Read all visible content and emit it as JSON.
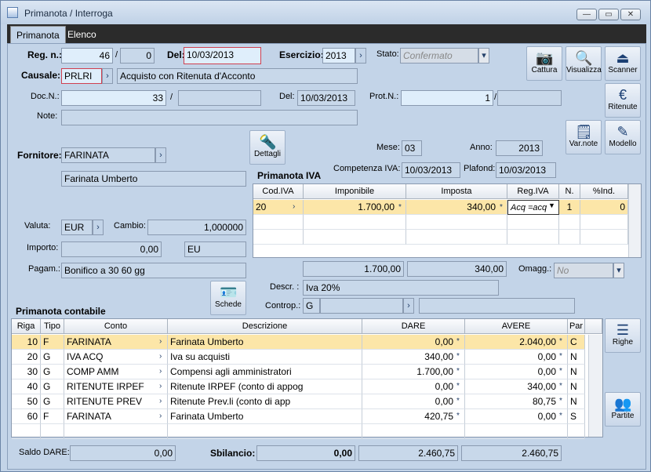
{
  "window": {
    "title": "Primanota / Interroga"
  },
  "tabs": [
    "Primanota",
    "Elenco"
  ],
  "header": {
    "reg_label": "Reg. n.:",
    "reg_num": "46",
    "reg_sep": "/",
    "reg_suffix": "0",
    "del_label": "Del:",
    "del_value": "10/03/2013",
    "esercizio_label": "Esercizio:",
    "esercizio_value": "2013",
    "stato_label": "Stato:",
    "stato_value": "Confermato",
    "causale_label": "Causale:",
    "causale_code": "PRLRI",
    "causale_desc": "Acquisto con Ritenuta d'Acconto",
    "docn_label": "Doc.N.:",
    "docn_value": "33",
    "docn_sep": "/",
    "docn_suffix": "",
    "docdel_label": "Del:",
    "docdel_value": "10/03/2013",
    "prot_label": "Prot.N.:",
    "prot_value": "1",
    "prot_sep": "/",
    "prot_suffix": "",
    "note_label": "Note:",
    "note_value": ""
  },
  "buttons": {
    "cattura": "Cattura",
    "visualizza": "Visualizza",
    "scanner": "Scanner",
    "ritenute": "Ritenute",
    "varnote": "Var.note",
    "modello": "Modello",
    "dettagli": "Dettagli",
    "schede": "Schede",
    "righe": "Righe",
    "partite": "Partite"
  },
  "fornitore": {
    "label": "Fornitore:",
    "code": "FARINATA",
    "name": "Farinata Umberto",
    "valuta_label": "Valuta:",
    "valuta": "EUR",
    "cambio_label": "Cambio:",
    "cambio": "1,000000",
    "importo_label": "Importo:",
    "importo": "0,00",
    "importo_cur": "EU",
    "pagam_label": "Pagam.:",
    "pagam": "Bonifico a 30 60 gg"
  },
  "iva": {
    "mese_label": "Mese:",
    "mese": "03",
    "anno_label": "Anno:",
    "anno": "2013",
    "comp_label": "Competenza IVA:",
    "comp": "10/03/2013",
    "plafond_label": "Plafond:",
    "plafond": "10/03/2013",
    "title": "Primanota IVA",
    "columns": [
      "Cod.IVA",
      "Imponibile",
      "Imposta",
      "Reg.IVA",
      "N.",
      "%Ind."
    ],
    "row": {
      "cod": "20",
      "imponibile": "1.700,00",
      "imposta": "340,00",
      "reg": "Acq =acq",
      "n": "1",
      "ind": "0"
    },
    "tot_imponibile": "1.700,00",
    "tot_imposta": "340,00",
    "omagg_label": "Omagg.:",
    "omagg": "No",
    "descr_label": "Descr. :",
    "descr": "Iva 20%",
    "controp_label": "Controp.:",
    "controp": "G"
  },
  "contabile": {
    "title": "Primanota contabile",
    "columns": [
      "Riga",
      "Tipo",
      "Conto",
      "Descrizione",
      "DARE",
      "AVERE",
      "Par"
    ],
    "rows": [
      {
        "riga": "10",
        "tipo": "F",
        "conto": "FARINATA",
        "desc": "Farinata Umberto",
        "dare": "0,00",
        "avere": "2.040,00",
        "par": "C"
      },
      {
        "riga": "20",
        "tipo": "G",
        "conto": "IVA ACQ",
        "desc": "Iva su acquisti",
        "dare": "340,00",
        "avere": "0,00",
        "par": "N"
      },
      {
        "riga": "30",
        "tipo": "G",
        "conto": "COMP AMM",
        "desc": "Compensi agli amministratori",
        "dare": "1.700,00",
        "avere": "0,00",
        "par": "N"
      },
      {
        "riga": "40",
        "tipo": "G",
        "conto": "RITENUTE IRPEF",
        "desc": "Ritenute IRPEF (conto di appog",
        "dare": "0,00",
        "avere": "340,00",
        "par": "N"
      },
      {
        "riga": "50",
        "tipo": "G",
        "conto": "RITENUTE PREV",
        "desc": "Ritenute Prev.li (conto di app",
        "dare": "0,00",
        "avere": "80,75",
        "par": "N"
      },
      {
        "riga": "60",
        "tipo": "F",
        "conto": "FARINATA",
        "desc": "Farinata Umberto",
        "dare": "420,75",
        "avere": "0,00",
        "par": "S"
      }
    ]
  },
  "footer": {
    "saldo_label": "Saldo DARE:",
    "saldo": "0,00",
    "sbil_label": "Sbilancio:",
    "sbil": "0,00",
    "tot_dare": "2.460,75",
    "tot_avere": "2.460,75"
  }
}
